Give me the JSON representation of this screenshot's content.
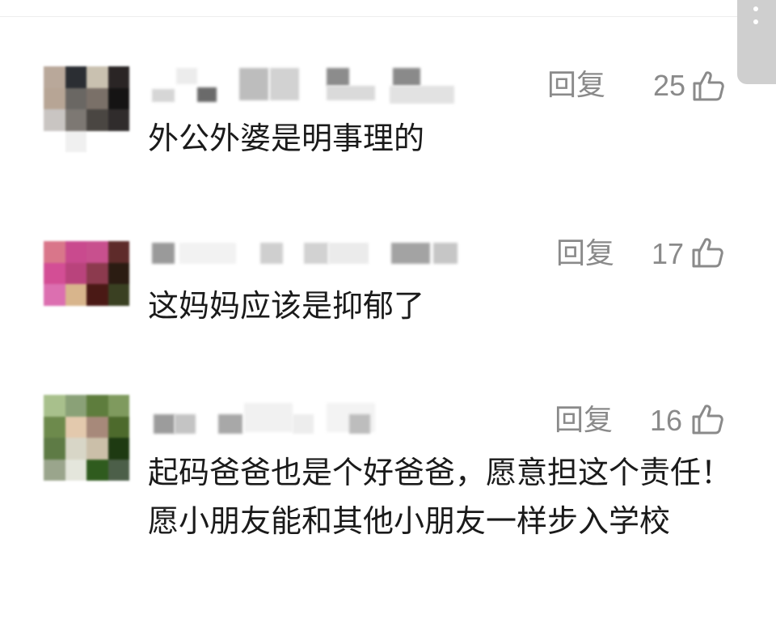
{
  "comments": [
    {
      "reply_label": "回复",
      "likes": "25",
      "text": "外公外婆是明事理的",
      "avatar_colors": [
        "#b9a89a",
        "#2b2e33",
        "#c9c1b0",
        "#2a2525",
        "#b7a595",
        "#6a6763",
        "#7a7068",
        "#151414",
        "#c9c5c2",
        "#7d7873",
        "#4a4642",
        "#302c2c",
        "#ffffff",
        "#f0f0f0",
        "#ffffff",
        "#ffffff"
      ]
    },
    {
      "reply_label": "回复",
      "likes": "17",
      "text": "这妈妈应该是抑郁了",
      "avatar_colors": [
        "#d9768a",
        "#c94a8e",
        "#c8508e",
        "#5e2b2a",
        "#d34e95",
        "#b9437c",
        "#8c3a4e",
        "#2b1c12",
        "#dc6fb0",
        "#d8b58c",
        "#4a1915",
        "#3a4022",
        "#ffffff",
        "#ffffff",
        "#ffffff",
        "#ffffff"
      ]
    },
    {
      "reply_label": "回复",
      "likes": "16",
      "text": "起码爸爸也是个好爸爸，愿意担这个责任！愿小朋友能和其他小朋友一样步入学校",
      "avatar_colors": [
        "#a8c08c",
        "#8aa177",
        "#5e7d3d",
        "#7f9a5e",
        "#6d8a4c",
        "#e3c9ad",
        "#a7897a",
        "#4d6a2c",
        "#5e7b45",
        "#d8d6c7",
        "#cbbfa9",
        "#1e3a12",
        "#9aa58c",
        "#e4e6dc",
        "#2f5b1e",
        "#4c5f49"
      ]
    }
  ]
}
